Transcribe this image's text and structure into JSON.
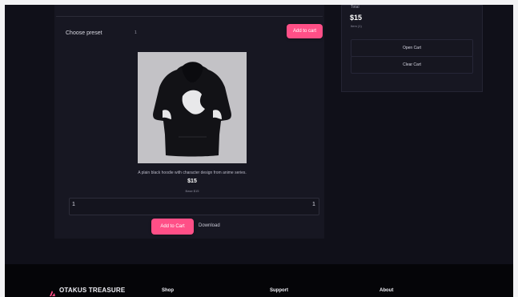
{
  "cart": {
    "label": "Total",
    "price": "$15",
    "sub": "Item (1)",
    "open_button": "Open Cart",
    "clear_button": "Clear Cart"
  },
  "product": {
    "preset_label": "Choose preset",
    "preset_value": "1",
    "add_top_button": "Add to cart",
    "description": "A plain black hoodie with character design from anime series.",
    "price": "$15",
    "sub_price": "Base $15",
    "slider_left": "1",
    "slider_right": "1",
    "buy_button": "Add to Cart",
    "download_link": "Download",
    "colors": {
      "accent": "#ff4f87",
      "background": "#101019",
      "panel": "#171722"
    }
  },
  "footer": {
    "brand": "OTAKUS TREASURE",
    "links": [
      "Shop",
      "Support",
      "About"
    ]
  }
}
